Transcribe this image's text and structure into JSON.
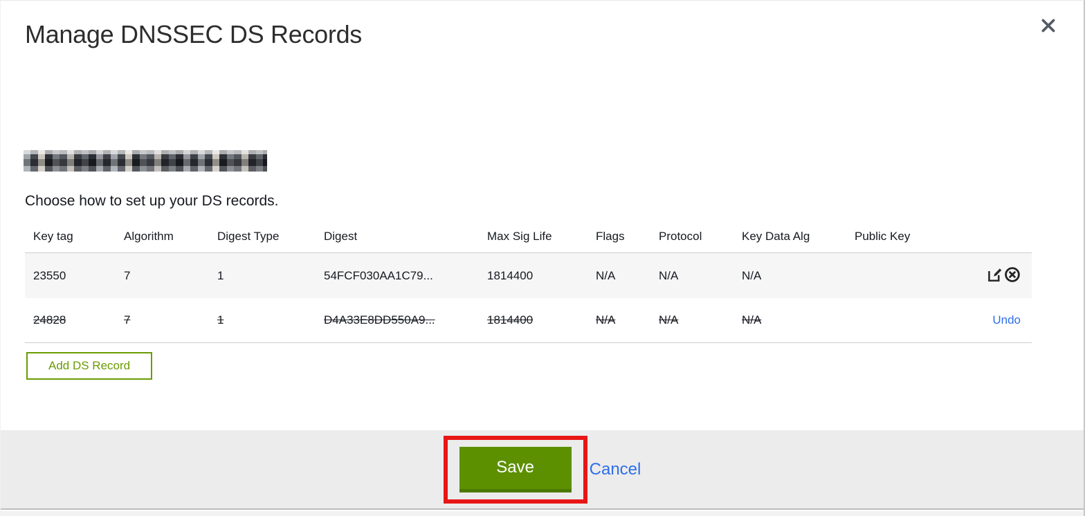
{
  "modal": {
    "title": "Manage DNSSEC DS Records",
    "close_icon": "x-close-icon"
  },
  "content": {
    "domain_redacted": true,
    "instruction": "Choose how to set up your DS records."
  },
  "table": {
    "columns": [
      "Key tag",
      "Algorithm",
      "Digest Type",
      "Digest",
      "Max Sig Life",
      "Flags",
      "Protocol",
      "Key Data Alg",
      "Public Key"
    ],
    "rows": [
      {
        "key_tag": "23550",
        "algorithm": "7",
        "digest_type": "1",
        "digest": "54FCF030AA1C79...",
        "max_sig_life": "1814400",
        "flags": "N/A",
        "protocol": "N/A",
        "key_data_alg": "N/A",
        "public_key": "",
        "state": "normal",
        "actions": [
          "edit",
          "delete"
        ]
      },
      {
        "key_tag": "24828",
        "algorithm": "7",
        "digest_type": "1",
        "digest": "D4A33E8DD550A9...",
        "max_sig_life": "1814400",
        "flags": "N/A",
        "protocol": "N/A",
        "key_data_alg": "N/A",
        "public_key": "",
        "state": "deleted",
        "undo_label": "Undo"
      }
    ]
  },
  "buttons": {
    "add_ds_record": "Add DS Record",
    "save": "Save",
    "cancel": "Cancel"
  },
  "colors": {
    "save_green": "#5d9000",
    "save_green_dark": "#4c7a00",
    "add_button_green": "#699b00",
    "link_blue": "#2e6fe8",
    "annotation_red": "#e81616",
    "row_stripe": "#f6f6f6",
    "footer_bg": "#ececec",
    "icon_dark": "#2b2b2b"
  }
}
